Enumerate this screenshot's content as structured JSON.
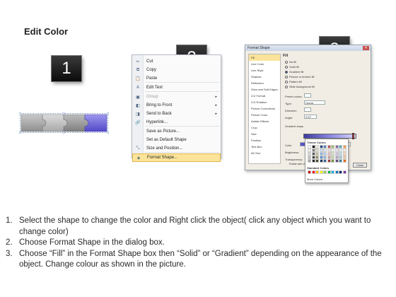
{
  "title": "Edit Color",
  "step_numbers": [
    "1",
    "2",
    "3"
  ],
  "accent": "#6b63d6",
  "puzzle_colors": [
    "#a9a9a9",
    "#bfbfbf",
    "#9b9b9b",
    "#6b63d6"
  ],
  "context_menu": {
    "items": [
      {
        "label": "Cut",
        "icon": "scissors-icon",
        "glyph": "✂",
        "arrow": ""
      },
      {
        "label": "Copy",
        "icon": "copy-icon",
        "glyph": "⧉",
        "arrow": ""
      },
      {
        "label": "Paste",
        "icon": "paste-icon",
        "glyph": "📋",
        "arrow": ""
      },
      {
        "label": "Edit Text",
        "icon": "edit-text-icon",
        "glyph": "A",
        "arrow": ""
      },
      {
        "label": "Group",
        "icon": "group-icon",
        "glyph": "▣",
        "arrow": "▸",
        "disabled": true
      },
      {
        "label": "Bring to Front",
        "icon": "bring-front-icon",
        "glyph": "◧",
        "arrow": "▸"
      },
      {
        "label": "Send to Back",
        "icon": "send-back-icon",
        "glyph": "◨",
        "arrow": "▸"
      },
      {
        "label": "Hyperlink...",
        "icon": "hyperlink-icon",
        "glyph": "🔗",
        "arrow": ""
      },
      {
        "label": "Save as Picture...",
        "icon": "",
        "glyph": "",
        "arrow": ""
      },
      {
        "label": "Set as Default Shape",
        "icon": "",
        "glyph": "",
        "arrow": ""
      },
      {
        "label": "Size and Position...",
        "icon": "size-position-icon",
        "glyph": "⤡",
        "arrow": ""
      },
      {
        "label": "Format Shape...",
        "icon": "format-shape-icon",
        "glyph": "◈",
        "arrow": "",
        "highlighted": true
      }
    ]
  },
  "dialog": {
    "title": "Format Shape",
    "categories": [
      "Fill",
      "Line Color",
      "Line Style",
      "Shadow",
      "Reflection",
      "Glow and Soft Edges",
      "3-D Format",
      "3-D Rotation",
      "Picture Corrections",
      "Picture Color",
      "Artistic Effects",
      "Crop",
      "Size",
      "Position",
      "Text Box",
      "Alt Text"
    ],
    "fill_heading": "Fill",
    "fill_options": [
      "No fill",
      "Solid fill",
      "Gradient fill",
      "Picture or texture fill",
      "Pattern fill",
      "Slide background fill"
    ],
    "preset_colors_label": "Preset colors:",
    "type_label": "Type:",
    "type_value": "Linear",
    "direction_label": "Direction:",
    "angle_label": "Angle:",
    "angle_value": "270°",
    "gradient_stops_label": "Gradient stops",
    "color_label": "Color",
    "position_label": "Position:",
    "position_value": "100%",
    "brightness_label": "Brightness:",
    "transparency_label": "Transparency:",
    "rotate_label": "Rotate with shape",
    "close_label": "Close"
  },
  "palette": {
    "theme_label": "Theme Colors",
    "standard_label": "Standard Colors",
    "more_label": "More Colors...",
    "theme_colors": [
      "#ffffff",
      "#000000",
      "#eeece1",
      "#1f497d",
      "#4f81bd",
      "#c0504d",
      "#9bbb59",
      "#8064a2",
      "#4bacc6",
      "#f79646",
      "#f2f2f2",
      "#7f7f7f",
      "#ddd9c3",
      "#c6d9f0",
      "#dbe5f1",
      "#f2dcdb",
      "#ebf1dd",
      "#e5e0ec",
      "#dbeef3",
      "#fdeada",
      "#d8d8d8",
      "#595959",
      "#c4bd97",
      "#8db3e2",
      "#b8cce4",
      "#e5b9b7",
      "#d7e3bc",
      "#ccc1d9",
      "#b7dde8",
      "#fbd5b5",
      "#bfbfbf",
      "#3f3f3f",
      "#938953",
      "#548dd4",
      "#95b3d7",
      "#d99694",
      "#c3d69b",
      "#b2a2c7",
      "#92cddc",
      "#fac08f",
      "#a5a5a5",
      "#262626",
      "#494429",
      "#17365d",
      "#366092",
      "#953734",
      "#76923c",
      "#5f497a",
      "#31859b",
      "#e36c09"
    ],
    "standard_colors": [
      "#c00000",
      "#ff0000",
      "#ffc000",
      "#ffff00",
      "#92d050",
      "#00b050",
      "#00b0f0",
      "#0070c0",
      "#002060",
      "#7030a0"
    ]
  },
  "instructions": [
    {
      "num": "1.",
      "text": "Select the shape to change the color and Right click the object( click any object which you want to change color)"
    },
    {
      "num": "2.",
      "text": "Choose Format Shape in the dialog box."
    },
    {
      "num": "3.",
      "text": "Choose “Fill” in the Format Shape box then “Solid” or “Gradient” depending on the appearance of the object. Change colour as shown in the picture."
    }
  ]
}
